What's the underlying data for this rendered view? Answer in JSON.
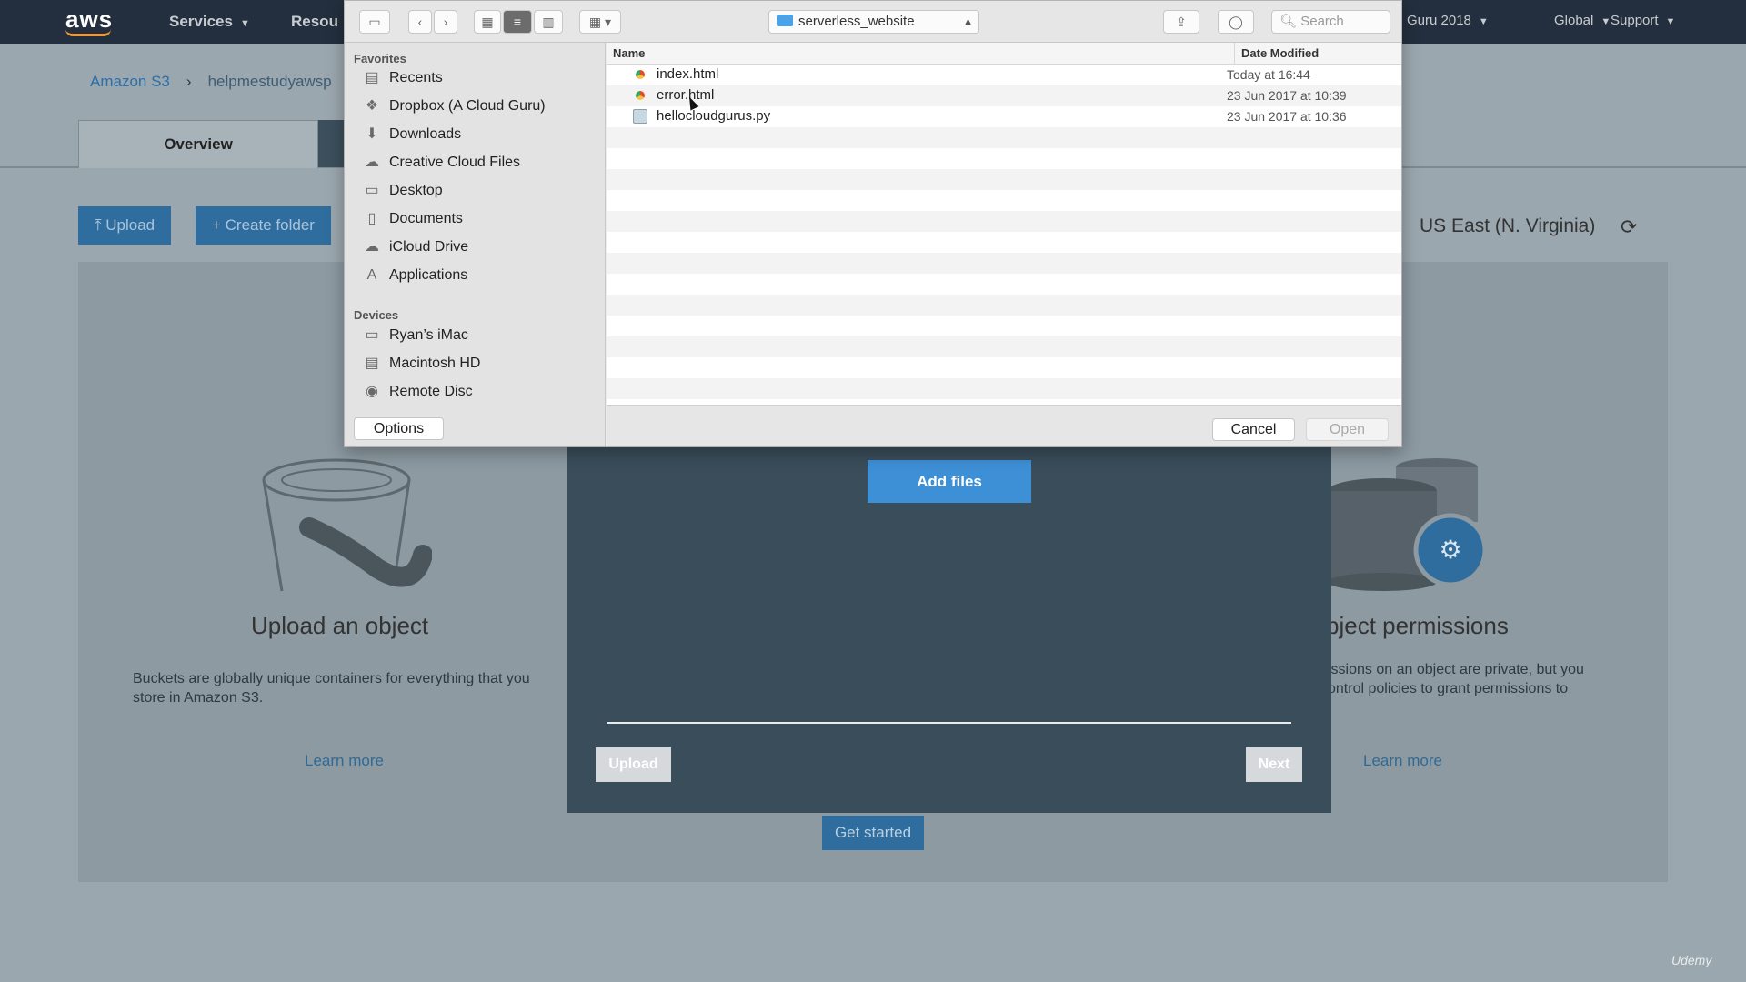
{
  "topnav": {
    "logo": "aws",
    "items": [
      "Services",
      "Resou",
      "Guru 2018",
      "Global",
      "Support"
    ]
  },
  "console": {
    "breadcrumb": [
      "Amazon S3",
      "helpmestudyawsp"
    ],
    "tabs": [
      "Overview"
    ],
    "upload_btn": "Upload",
    "create_folder_btn": "Create folder",
    "region": "US East (N. Virginia)",
    "card_left": {
      "title": "Upload an object",
      "text": "Buckets are globally unique containers for everything that you store in Amazon S3.",
      "link": "Learn more"
    },
    "card_right": {
      "title": "bject permissions",
      "text_1": "issions on an object are private, but you",
      "text_2": "ontrol policies to grant permissions to",
      "link": "Learn more"
    },
    "get_started": "Get started"
  },
  "upload_dialog": {
    "add_files": "Add files",
    "upload": "Upload",
    "next": "Next"
  },
  "picker": {
    "folder": "serverless_website",
    "search_placeholder": "Search",
    "sidebar": {
      "favorites_heading": "Favorites",
      "favorites": [
        {
          "label": "Recents",
          "icon": "recents-icon"
        },
        {
          "label": "Dropbox (A Cloud Guru)",
          "icon": "dropbox-icon"
        },
        {
          "label": "Downloads",
          "icon": "downloads-icon"
        },
        {
          "label": "Creative Cloud Files",
          "icon": "creative-cloud-icon"
        },
        {
          "label": "Desktop",
          "icon": "desktop-icon"
        },
        {
          "label": "Documents",
          "icon": "documents-icon"
        },
        {
          "label": "iCloud Drive",
          "icon": "icloud-icon"
        },
        {
          "label": "Applications",
          "icon": "applications-icon"
        }
      ],
      "devices_heading": "Devices",
      "devices": [
        {
          "label": "Ryan’s iMac",
          "icon": "imac-icon"
        },
        {
          "label": "Macintosh HD",
          "icon": "hard-disk-icon"
        },
        {
          "label": "Remote Disc",
          "icon": "disc-icon"
        }
      ]
    },
    "columns": {
      "name": "Name",
      "date": "Date Modified"
    },
    "files": [
      {
        "name": "index.html",
        "date": "Today at 16:44",
        "type": "html"
      },
      {
        "name": "error.html",
        "date": "23 Jun 2017 at 10:39",
        "type": "html"
      },
      {
        "name": "hellocloudgurus.py",
        "date": "23 Jun 2017 at 10:36",
        "type": "py"
      }
    ],
    "options": "Options",
    "cancel": "Cancel",
    "open": "Open"
  },
  "watermark": "Udemy"
}
